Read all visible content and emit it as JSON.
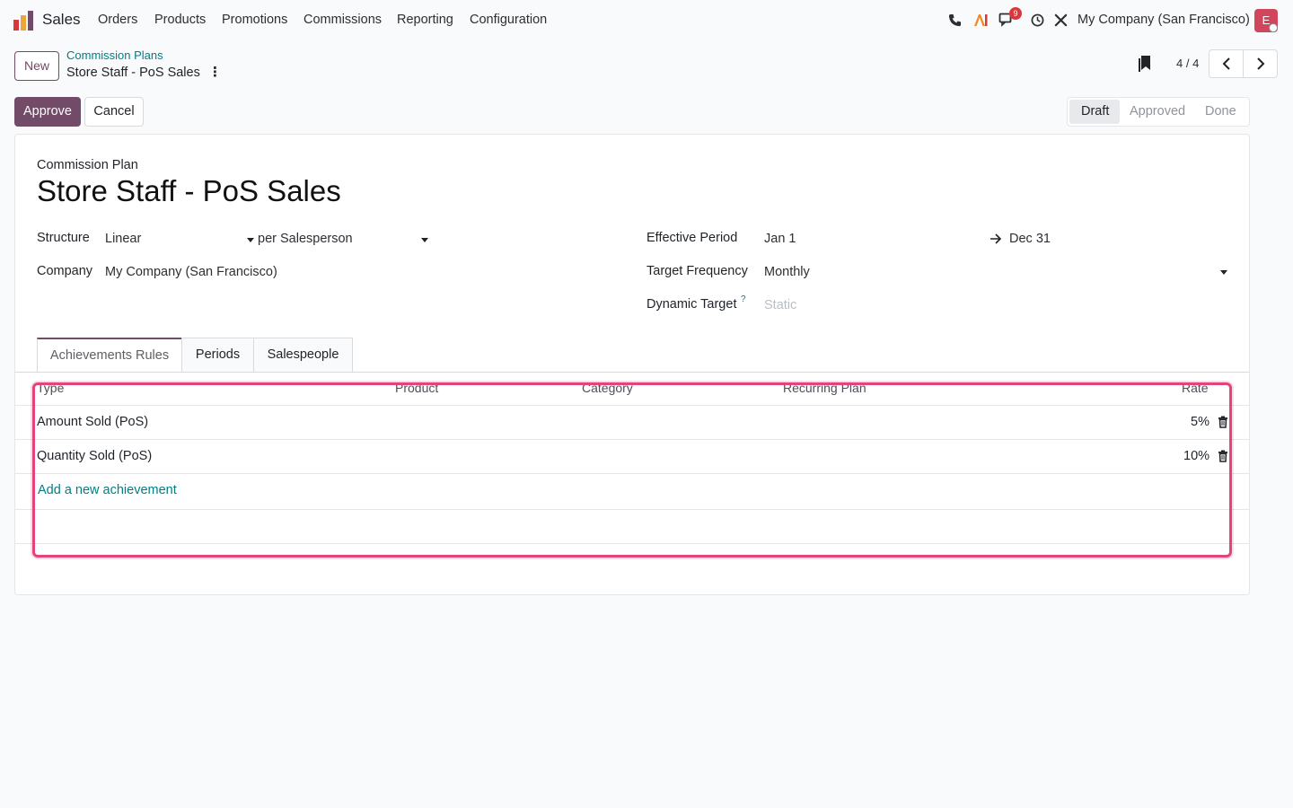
{
  "nav": {
    "app_name": "Sales",
    "menu": [
      "Orders",
      "Products",
      "Promotions",
      "Commissions",
      "Reporting",
      "Configuration"
    ],
    "notification_count": "9",
    "company": "My Company (San Francisco)",
    "avatar_letter": "E"
  },
  "control": {
    "new_label": "New",
    "breadcrumb_parent": "Commission Plans",
    "breadcrumb_current": "Store Staff - PoS Sales",
    "pager": "4 / 4",
    "approve_label": "Approve",
    "cancel_label": "Cancel",
    "statuses": [
      "Draft",
      "Approved",
      "Done"
    ],
    "active_status": "Draft"
  },
  "form": {
    "record_type": "Commission Plan",
    "title": "Store Staff - PoS Sales",
    "structure_label": "Structure",
    "structure_value": "Linear",
    "per_value": "per Salesperson",
    "company_label": "Company",
    "company_value": "My Company (San Francisco)",
    "effective_label": "Effective Period",
    "effective_start": "Jan 1",
    "effective_end": "Dec 31",
    "target_freq_label": "Target Frequency",
    "target_freq_value": "Monthly",
    "dynamic_label": "Dynamic Target",
    "dynamic_help": "?",
    "dynamic_value": "Static"
  },
  "tabs": [
    "Achievements Rules",
    "Periods",
    "Salespeople"
  ],
  "table": {
    "headers": [
      "Type",
      "Product",
      "Category",
      "Recurring Plan",
      "Rate"
    ],
    "rows": [
      {
        "type": "Amount Sold (PoS)",
        "rate": "5%"
      },
      {
        "type": "Quantity Sold (PoS)",
        "rate": "10%"
      }
    ],
    "add_label": "Add a new achievement"
  },
  "colors": {
    "brand": "#714b67",
    "link": "#017e84",
    "highlight": "#e0457b"
  }
}
